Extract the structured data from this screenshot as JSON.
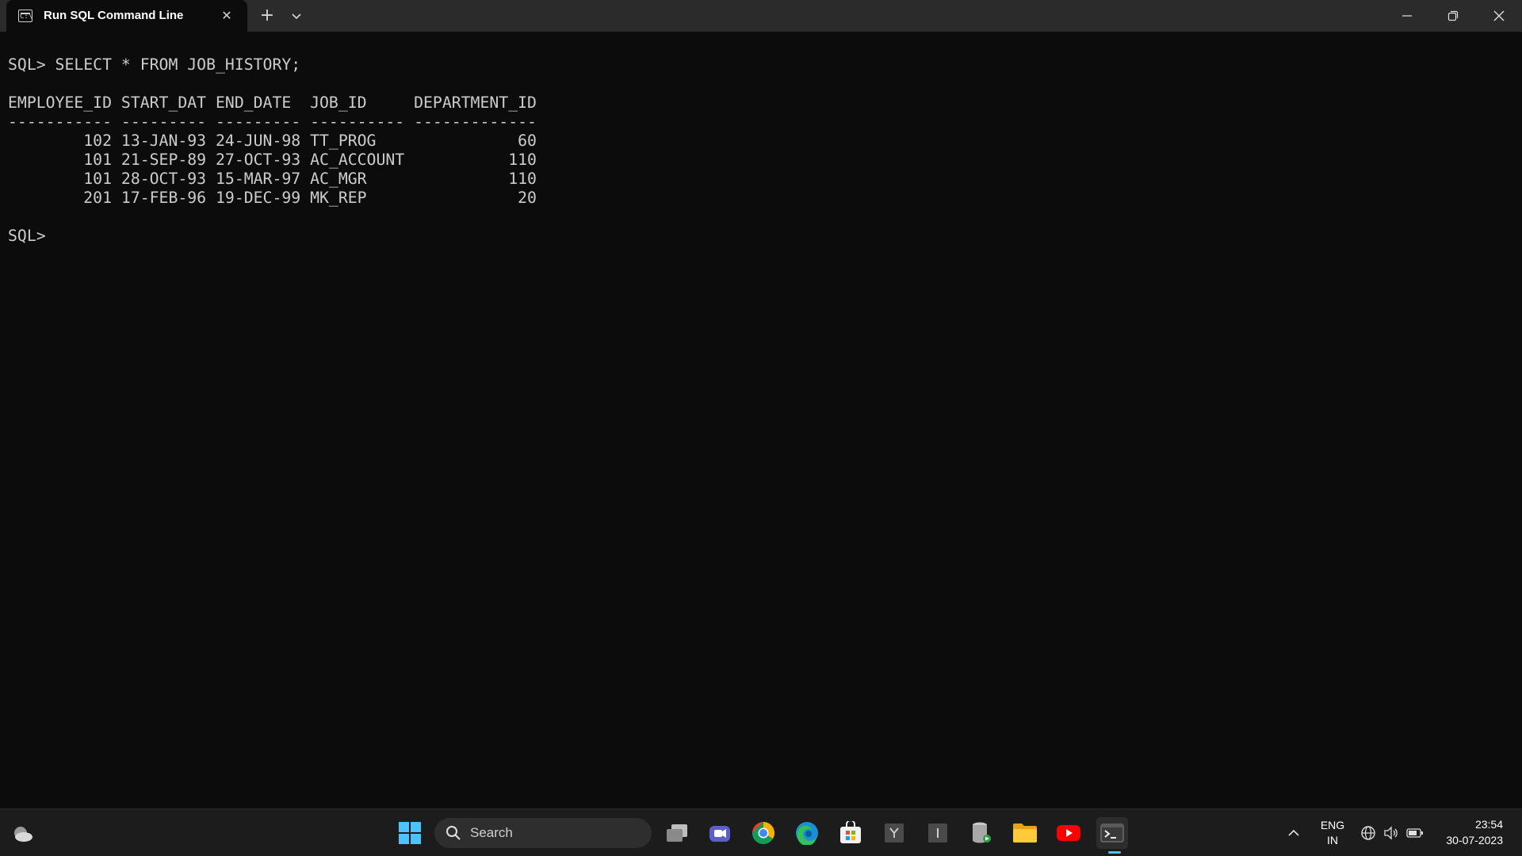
{
  "window": {
    "tab_title": "Run SQL Command Line",
    "tab_close_glyph": "✕",
    "new_tab_glyph": "+",
    "tab_icon_glyph": "C:\\"
  },
  "terminal": {
    "lines": [
      "SQL> SELECT * FROM JOB_HISTORY;",
      "",
      "EMPLOYEE_ID START_DAT END_DATE  JOB_ID     DEPARTMENT_ID",
      "----------- --------- --------- ---------- -------------",
      "        102 13-JAN-93 24-JUN-98 TT_PROG               60",
      "        101 21-SEP-89 27-OCT-93 AC_ACCOUNT           110",
      "        101 28-OCT-93 15-MAR-97 AC_MGR               110",
      "        201 17-FEB-96 19-DEC-99 MK_REP                20",
      "",
      "SQL>"
    ]
  },
  "taskbar": {
    "search_label": "Search",
    "apps": [
      {
        "name": "start",
        "icon": "windows-logo-icon"
      },
      {
        "name": "task-view",
        "icon": "task-view-icon"
      },
      {
        "name": "teams",
        "icon": "video-camera-icon"
      },
      {
        "name": "chrome",
        "icon": "chrome-icon"
      },
      {
        "name": "edge",
        "icon": "edge-icon"
      },
      {
        "name": "store",
        "icon": "store-icon"
      },
      {
        "name": "app-y",
        "icon": "app-y-icon",
        "letter": "Y"
      },
      {
        "name": "app-i",
        "icon": "app-i-icon",
        "letter": "I"
      },
      {
        "name": "database",
        "icon": "database-icon"
      },
      {
        "name": "file-explorer",
        "icon": "folder-icon"
      },
      {
        "name": "youtube",
        "icon": "youtube-icon"
      },
      {
        "name": "terminal",
        "icon": "terminal-icon"
      }
    ],
    "tray": {
      "language_line1": "ENG",
      "language_line2": "IN",
      "time": "23:54",
      "date": "30-07-2023"
    }
  },
  "colors": {
    "terminal_bg": "#0c0c0c",
    "terminal_text": "#cccccc",
    "titlebar_bg": "#2b2b2b",
    "taskbar_bg": "#1c1c1c",
    "accent": "#4cc2ff"
  }
}
